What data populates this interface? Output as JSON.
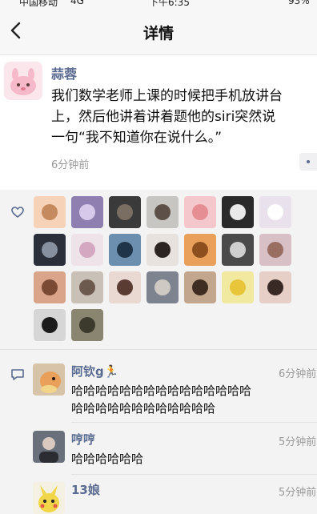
{
  "status_bar": {
    "carrier": "中国移动",
    "network": "4G",
    "time": "下午6:35",
    "battery": "93%"
  },
  "nav": {
    "title": "详情"
  },
  "post": {
    "author": "蒜蓉",
    "lines": [
      "我们数学老师上课的时候把手机放讲台",
      "上，然后他讲着讲着题他的siri突然说",
      "一句“我不知道你在说什么。”"
    ],
    "time": "6分钟前"
  },
  "likes": {
    "avatar_colors": [
      [
        "#f6d2b8",
        "#c58a5e"
      ],
      [
        "#8e7fb0",
        "#d7c9e9"
      ],
      [
        "#3b3a3a",
        "#7a6e63"
      ],
      [
        "#c8c6c2",
        "#5d5048"
      ],
      [
        "#f3c7cb",
        "#e58f94"
      ],
      [
        "#2a2a2a",
        "#e9e9e9"
      ],
      [
        "#e9e1ec",
        "#ffffff"
      ],
      [
        "#2b2f39",
        "#86909e"
      ],
      [
        "#efe3ea",
        "#d4a8c0"
      ],
      [
        "#6c8fb0",
        "#1f3448"
      ],
      [
        "#e8e2de",
        "#2b2422"
      ],
      [
        "#e9a05a",
        "#8e4f1f"
      ],
      [
        "#4a4a4a",
        "#cfcfcf"
      ],
      [
        "#d7c0c6",
        "#9a6f63"
      ],
      [
        "#d9a48a",
        "#7a4a34"
      ],
      [
        "#c9c0b8",
        "#6d5a4e"
      ],
      [
        "#e9d9d2",
        "#5a3c33"
      ],
      [
        "#7d8490",
        "#cfc9c3"
      ],
      [
        "#c2a68e",
        "#3f2c22"
      ],
      [
        "#f2e9a0",
        "#e8c53a"
      ],
      [
        "#e5cfc6",
        "#3a2a26"
      ],
      [
        "#d6d6d6",
        "#1b1b1b"
      ],
      [
        "#8a8570",
        "#3b3a2c"
      ]
    ]
  },
  "comments": [
    {
      "name": "阿钦g🏃",
      "time": "6分钟前",
      "lines": [
        "哈哈哈哈哈哈哈哈哈哈哈哈哈哈哈",
        "哈哈哈哈哈哈哈哈哈哈哈哈"
      ],
      "avatar_colors": [
        "#e9a05a",
        "#8e4f1f"
      ]
    },
    {
      "name": "哼哼",
      "time": "5分钟前",
      "lines": [
        "哈哈哈哈哈哈"
      ],
      "avatar_colors": [
        "#6a6f7c",
        "#d9d9d9"
      ]
    },
    {
      "name": "13娘",
      "time": "5分钟前",
      "lines": [],
      "avatar_colors": [
        "#f2e9a0",
        "#e8c53a"
      ]
    }
  ]
}
